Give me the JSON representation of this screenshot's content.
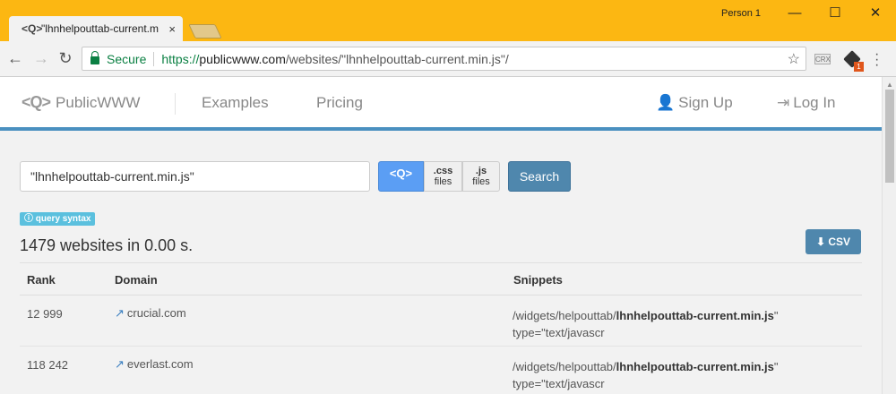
{
  "browser": {
    "tab_title": "\"lhnhelpouttab-current.m",
    "tab_favicon": "<Q>",
    "tab_close": "×",
    "profile": "Person 1",
    "minimize": "—",
    "maximize": "☐",
    "close": "✕",
    "secure_label": "Secure",
    "url_protocol": "https://",
    "url_host": "publicwww.com",
    "url_path": "/websites/\"lhnhelpouttab-current.min.js\"/",
    "ext_crx": "CRX",
    "ext_badge_count": "1"
  },
  "site_nav": {
    "logo_mark": "<Q>",
    "logo_text": "PublicWWW",
    "examples": "Examples",
    "pricing": "Pricing",
    "sign_up": "Sign Up",
    "log_in": "Log In"
  },
  "search": {
    "value": "\"lhnhelpouttab-current.min.js\"",
    "code_btn": "<Q>",
    "css_top": ".css",
    "css_bottom": "files",
    "js_top": ".js",
    "js_bottom": "files",
    "submit": "Search"
  },
  "results": {
    "syntax_badge": "query syntax",
    "count_text": "1479 websites in 0.00 s.",
    "csv_label": "CSV",
    "headers": [
      "Rank",
      "Domain",
      "Snippets"
    ],
    "rows": [
      {
        "rank": "12 999",
        "domain": "crucial.com",
        "snip_pre": "/widgets/helpouttab/",
        "snip_bold": "lhnhelpouttab-current.min.js",
        "snip_post": "\"",
        "snip_line2": "type=\"text/javascr"
      },
      {
        "rank": "118 242",
        "domain": "everlast.com",
        "snip_pre": "/widgets/helpouttab/",
        "snip_bold": "lhnhelpouttab-current.min.js",
        "snip_post": "\"",
        "snip_line2": "type=\"text/javascr"
      }
    ]
  },
  "colors": {
    "titlebar": "#fcb712",
    "accent": "#4f87ad",
    "nav_border": "#4a90c0",
    "secure_green": "#0b8043",
    "badge": "#5bc0de"
  }
}
